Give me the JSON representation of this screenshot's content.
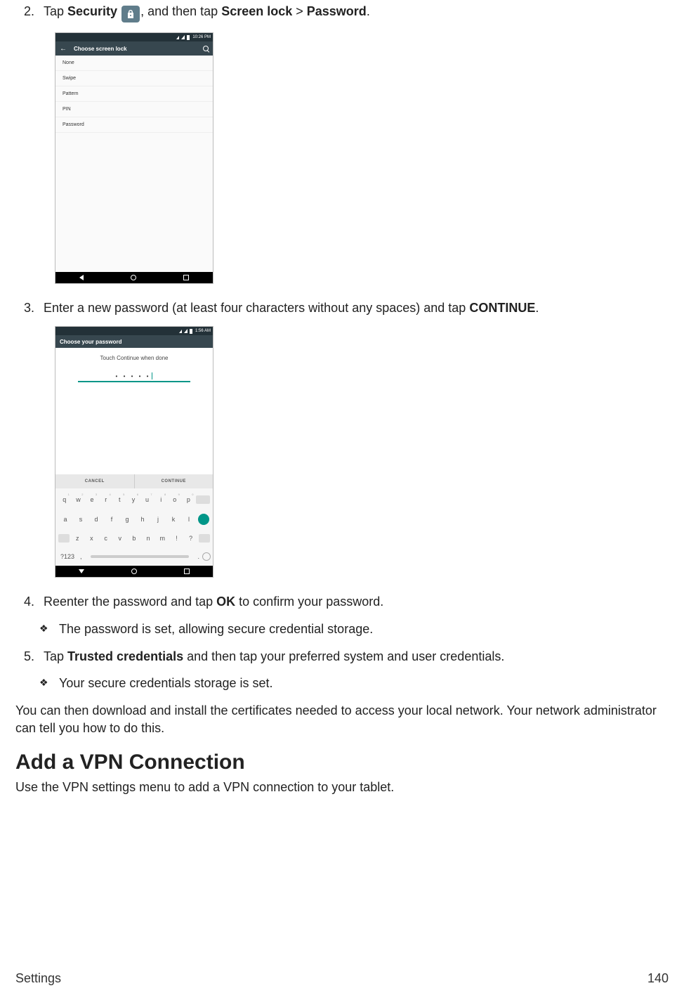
{
  "steps": {
    "s2_num": "2.",
    "s2_a": "Tap ",
    "s2_b": "Security",
    "s2_c": ", and then tap ",
    "s2_d": "Screen lock",
    "s2_e": " > ",
    "s2_f": "Password",
    "s2_g": ".",
    "s3_num": "3.",
    "s3_a": "Enter a new password (at least four characters without any spaces) and tap ",
    "s3_b": "CONTINUE",
    "s3_c": ".",
    "s4_num": "4.",
    "s4_a": "Reenter the password and tap ",
    "s4_b": "OK",
    "s4_c": " to confirm your password.",
    "s5_num": "5.",
    "s5_a": "Tap ",
    "s5_b": "Trusted credentials",
    "s5_c": " and then tap your preferred system and user credentials."
  },
  "bullets": {
    "glyph": "❖",
    "b1": "The password is set, allowing secure credential storage.",
    "b2": "Your secure credentials storage is set."
  },
  "para1": "You can then download and install the certificates needed to access your local network. Your network administrator can tell you how to do this.",
  "heading": "Add a VPN Connection",
  "para2": "Use the VPN settings menu to add a VPN connection to your tablet.",
  "footer_left": "Settings",
  "footer_right": "140",
  "phone1": {
    "time": "10:26 PM",
    "title": "Choose screen lock",
    "rows": [
      "None",
      "Swipe",
      "Pattern",
      "PIN",
      "Password"
    ]
  },
  "phone2": {
    "time": "1:56 AM",
    "title": "Choose your password",
    "msg": "Touch Continue when done",
    "dots": "• • • • •",
    "cancel": "CANCEL",
    "continue": "CONTINUE",
    "row1": [
      "q",
      "w",
      "e",
      "r",
      "t",
      "y",
      "u",
      "i",
      "o",
      "p"
    ],
    "row1_sup": [
      "1",
      "2",
      "3",
      "4",
      "5",
      "6",
      "7",
      "8",
      "9",
      "0"
    ],
    "row2": [
      "a",
      "s",
      "d",
      "f",
      "g",
      "h",
      "j",
      "k",
      "l"
    ],
    "row3": [
      "z",
      "x",
      "c",
      "v",
      "b",
      "n",
      "m",
      "!",
      "?"
    ],
    "sym": "?123"
  }
}
